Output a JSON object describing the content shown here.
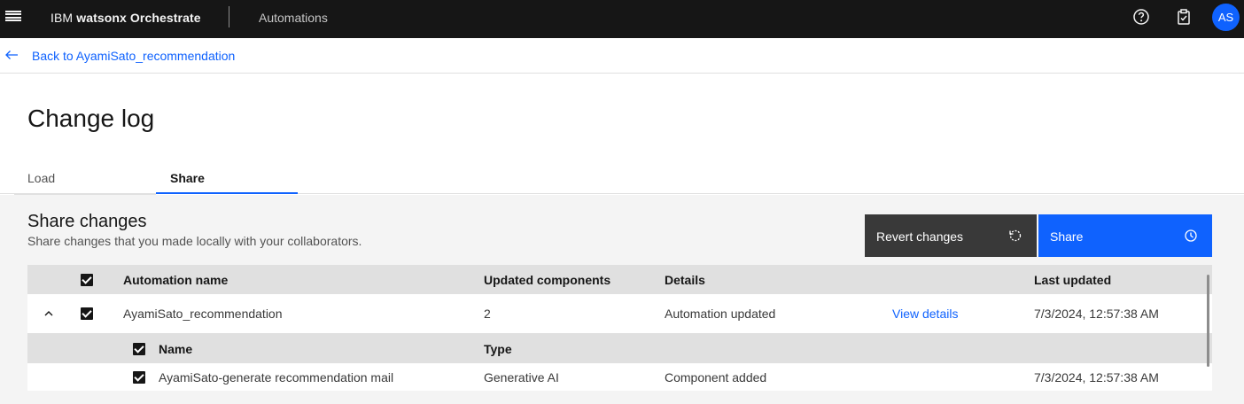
{
  "header": {
    "brand_prefix": "IBM",
    "brand_name": "watsonx Orchestrate",
    "nav_item": "Automations",
    "avatar_initials": "AS"
  },
  "back": {
    "label": "Back to AyamiSato_recommendation"
  },
  "page": {
    "title": "Change log"
  },
  "tabs": [
    {
      "label": "Load"
    },
    {
      "label": "Share"
    }
  ],
  "share": {
    "title": "Share changes",
    "description": "Share changes that you made locally with your collaborators.",
    "revert_label": "Revert changes",
    "share_label": "Share"
  },
  "table": {
    "columns": {
      "name": "Automation name",
      "components": "Updated components",
      "details": "Details",
      "last_updated": "Last updated"
    },
    "row": {
      "name": "AyamiSato_recommendation",
      "components": "2",
      "details": "Automation updated",
      "link": "View details",
      "last_updated": "7/3/2024, 12:57:38 AM"
    },
    "sub_columns": {
      "name": "Name",
      "type": "Type"
    },
    "sub_row": {
      "name": "AyamiSato-generate recommendation mail",
      "type": "Generative AI",
      "details": "Component added",
      "last_updated": "7/3/2024, 12:57:38 AM"
    }
  },
  "colors": {
    "accent": "#0f62fe",
    "header_bg": "#161616",
    "panel_bg": "#f4f4f4"
  }
}
